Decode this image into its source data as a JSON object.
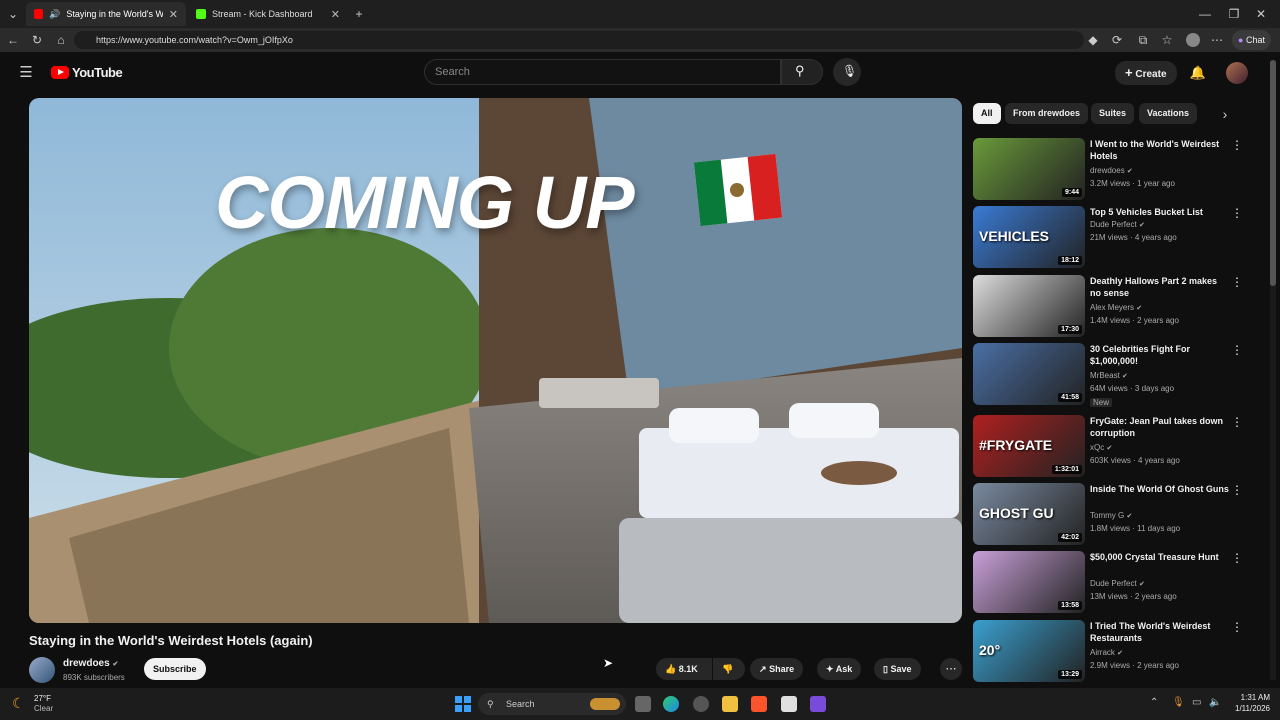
{
  "browser": {
    "tabs": [
      {
        "title": "Staying in the World's Weirde",
        "active": true
      },
      {
        "title": "Stream - Kick Dashboard",
        "active": false
      }
    ],
    "url": "https://www.youtube.com/watch?v=Owm_jOIfpXo",
    "chat_label": "Chat"
  },
  "youtube": {
    "logo": "YouTube",
    "search_placeholder": "Search",
    "create_label": "Create"
  },
  "video": {
    "overlay_text": "COMING UP",
    "title": "Staying in the World's Weirdest Hotels (again)",
    "channel": "drewdoes",
    "subscribers": "893K subscribers",
    "subscribe_label": "Subscribe",
    "likes": "8.1K",
    "share_label": "Share",
    "ask_label": "Ask",
    "save_label": "Save"
  },
  "chips": [
    "All",
    "From drewdoes",
    "Suites",
    "Vacations"
  ],
  "recommendations": [
    {
      "title": "I Went to the World's Weirdest Hotels",
      "channel": "drewdoes",
      "views": "3.2M views · 1 year ago",
      "duration": "9:44",
      "color": "#6a9a3a"
    },
    {
      "title": "Top 5 Vehicles Bucket List",
      "channel": "Dude Perfect",
      "views": "21M views · 4 years ago",
      "duration": "18:12",
      "color": "#3a7bd5",
      "thumb_text": "VEHICLES"
    },
    {
      "title": "Deathly Hallows Part 2 makes no sense",
      "channel": "Alex Meyers",
      "views": "1.4M views · 2 years ago",
      "duration": "17:30",
      "color": "#dddddd"
    },
    {
      "title": "30 Celebrities Fight For $1,000,000!",
      "channel": "MrBeast",
      "views": "64M views · 3 days ago",
      "duration": "41:58",
      "color": "#4a6fa5",
      "badge": "New"
    },
    {
      "title": "FryGate: Jean Paul takes down corruption",
      "channel": "xQc",
      "views": "603K views · 4 years ago",
      "duration": "1:32:01",
      "color": "#b02020",
      "thumb_text": "#FRYGATE"
    },
    {
      "title": "Inside The World Of Ghost Guns",
      "channel": "Tommy G",
      "views": "1.8M views · 11 days ago",
      "duration": "42:02",
      "color": "#7a8aa0",
      "thumb_text": "GHOST GU"
    },
    {
      "title": "$50,000 Crystal Treasure Hunt",
      "channel": "Dude Perfect",
      "views": "13M views · 2 years ago",
      "duration": "13:58",
      "color": "#c8a0d8"
    },
    {
      "title": "I Tried The World's Weirdest Restaurants",
      "channel": "Airrack",
      "views": "2.9M views · 2 years ago",
      "duration": "13:29",
      "color": "#3aa0d0",
      "thumb_text": "20°"
    }
  ],
  "taskbar": {
    "weather_temp": "27°F",
    "weather_desc": "Clear",
    "search_label": "Search",
    "time": "1:31 AM",
    "date": "1/11/2026"
  }
}
